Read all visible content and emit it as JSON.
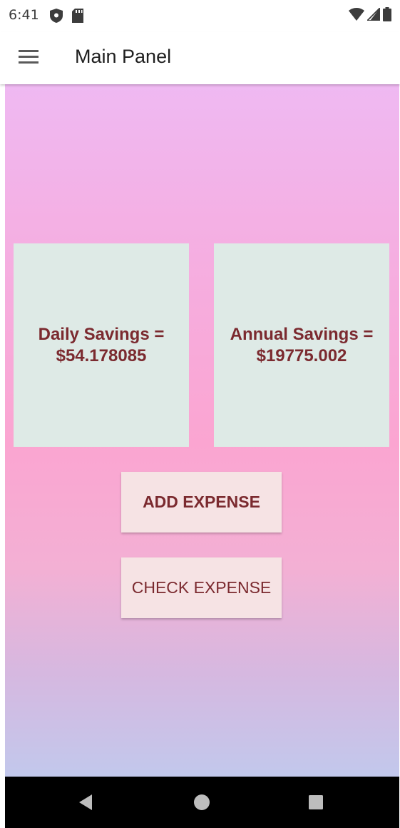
{
  "status_bar": {
    "time": "6:41"
  },
  "app_bar": {
    "title": "Main Panel"
  },
  "cards": {
    "daily": {
      "label": "Daily Savings =",
      "value": "$54.178085"
    },
    "annual": {
      "label": "Annual Savings =",
      "value": "$19775.002"
    }
  },
  "buttons": {
    "add_expense": "ADD EXPENSE",
    "check_expense": "CHECK EXPENSE"
  },
  "colors": {
    "accent_text": "#7b2a2f",
    "card_bg": "#deeae6",
    "button_bg": "#f6e3e4"
  },
  "icons": {
    "status_left": [
      "shield-icon",
      "sd-card-icon"
    ],
    "status_right": [
      "wifi-icon",
      "signal-icon",
      "battery-icon"
    ],
    "menu": "hamburger-menu-icon",
    "nav": [
      "back-icon",
      "home-icon",
      "recents-icon"
    ]
  }
}
